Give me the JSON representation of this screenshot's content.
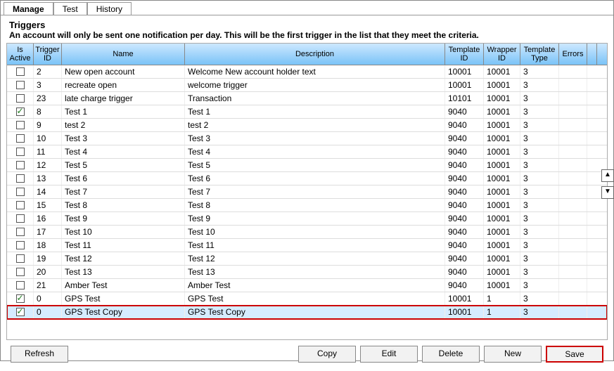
{
  "tabs": {
    "manage": "Manage",
    "test": "Test",
    "history": "History"
  },
  "section": {
    "title": "Triggers",
    "sub": "An account will only be sent one notification per day.   This will be the first trigger in the list that they meet the criteria."
  },
  "headers": {
    "is_active": "Is Active",
    "trigger_id": "Trigger ID",
    "name": "Name",
    "description": "Description",
    "template_id": "Template ID",
    "wrapper_id": "Wrapper ID",
    "template_type": "Template Type",
    "errors": "Errors"
  },
  "buttons": {
    "refresh": "Refresh",
    "copy": "Copy",
    "edit": "Edit",
    "delete": "Delete",
    "new": "New",
    "save": "Save"
  },
  "rows": [
    {
      "active": false,
      "tid": "2",
      "name": "New open account",
      "desc": "Welcome New account holder text",
      "tpl": "10001",
      "wrp": "10001",
      "typ": "3",
      "err": ""
    },
    {
      "active": false,
      "tid": "3",
      "name": "recreate open",
      "desc": "welcome trigger",
      "tpl": "10001",
      "wrp": "10001",
      "typ": "3",
      "err": ""
    },
    {
      "active": false,
      "tid": "23",
      "name": "late charge trigger",
      "desc": "Transaction",
      "tpl": "10101",
      "wrp": "10001",
      "typ": "3",
      "err": ""
    },
    {
      "active": true,
      "tid": "8",
      "name": "Test 1",
      "desc": "Test 1",
      "tpl": "9040",
      "wrp": "10001",
      "typ": "3",
      "err": ""
    },
    {
      "active": false,
      "tid": "9",
      "name": "test 2",
      "desc": "test 2",
      "tpl": "9040",
      "wrp": "10001",
      "typ": "3",
      "err": ""
    },
    {
      "active": false,
      "tid": "10",
      "name": "Test 3",
      "desc": "Test 3",
      "tpl": "9040",
      "wrp": "10001",
      "typ": "3",
      "err": ""
    },
    {
      "active": false,
      "tid": "11",
      "name": "Test 4",
      "desc": "Test 4",
      "tpl": "9040",
      "wrp": "10001",
      "typ": "3",
      "err": ""
    },
    {
      "active": false,
      "tid": "12",
      "name": "Test 5",
      "desc": "Test 5",
      "tpl": "9040",
      "wrp": "10001",
      "typ": "3",
      "err": ""
    },
    {
      "active": false,
      "tid": "13",
      "name": "Test 6",
      "desc": "Test 6",
      "tpl": "9040",
      "wrp": "10001",
      "typ": "3",
      "err": ""
    },
    {
      "active": false,
      "tid": "14",
      "name": "Test 7",
      "desc": "Test 7",
      "tpl": "9040",
      "wrp": "10001",
      "typ": "3",
      "err": ""
    },
    {
      "active": false,
      "tid": "15",
      "name": "Test 8",
      "desc": "Test 8",
      "tpl": "9040",
      "wrp": "10001",
      "typ": "3",
      "err": ""
    },
    {
      "active": false,
      "tid": "16",
      "name": "Test 9",
      "desc": "Test 9",
      "tpl": "9040",
      "wrp": "10001",
      "typ": "3",
      "err": ""
    },
    {
      "active": false,
      "tid": "17",
      "name": "Test 10",
      "desc": "Test 10",
      "tpl": "9040",
      "wrp": "10001",
      "typ": "3",
      "err": ""
    },
    {
      "active": false,
      "tid": "18",
      "name": "Test 11",
      "desc": "Test 11",
      "tpl": "9040",
      "wrp": "10001",
      "typ": "3",
      "err": ""
    },
    {
      "active": false,
      "tid": "19",
      "name": "Test 12",
      "desc": "Test 12",
      "tpl": "9040",
      "wrp": "10001",
      "typ": "3",
      "err": ""
    },
    {
      "active": false,
      "tid": "20",
      "name": "Test 13",
      "desc": "Test 13",
      "tpl": "9040",
      "wrp": "10001",
      "typ": "3",
      "err": ""
    },
    {
      "active": false,
      "tid": "21",
      "name": "Amber Test",
      "desc": "Amber Test",
      "tpl": "9040",
      "wrp": "10001",
      "typ": "3",
      "err": ""
    },
    {
      "active": true,
      "tid": "0",
      "name": "GPS Test",
      "desc": "GPS Test",
      "tpl": "10001",
      "wrp": "1",
      "typ": "3",
      "err": ""
    },
    {
      "active": true,
      "tid": "0",
      "name": "GPS Test Copy",
      "desc": "GPS Test Copy",
      "tpl": "10001",
      "wrp": "1",
      "typ": "3",
      "err": "",
      "selected": true
    }
  ]
}
